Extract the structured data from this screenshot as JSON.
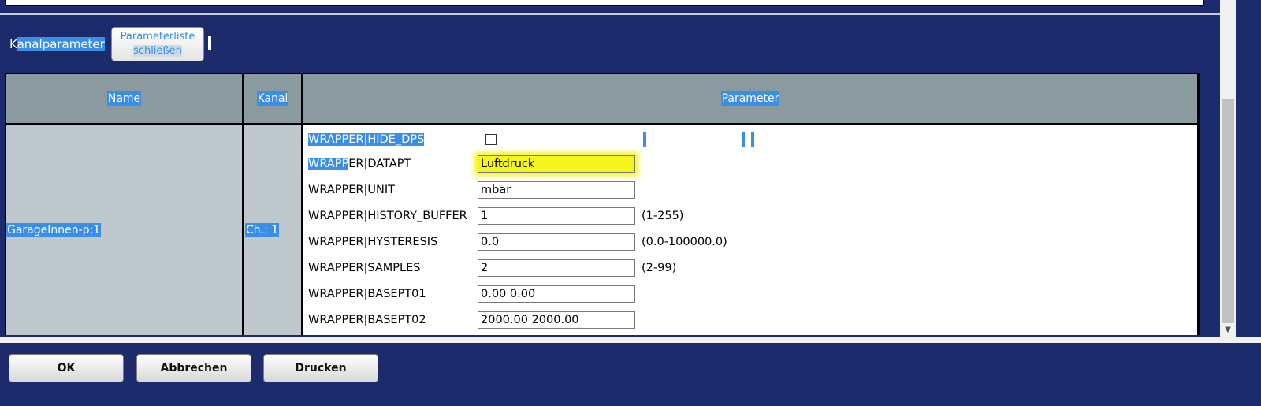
{
  "header": {
    "kanalparameter_first": "K",
    "kanalparameter_rest": "analparameter",
    "close_button_line1": "Parameterliste",
    "close_button_line2": "schließen"
  },
  "table": {
    "columns": {
      "name": "Name",
      "kanal": "Kanal",
      "parameter": "Parameter"
    },
    "row": {
      "name": "GarageInnen-p:1",
      "kanal": "Ch.: 1"
    }
  },
  "params": [
    {
      "label": "WRAPPER|HIDE_DPS",
      "type": "checkbox",
      "checked": false
    },
    {
      "label_selected": "WRAPP",
      "label_rest": "ER|DATAPT",
      "value": "Luftdruck",
      "highlighted": true
    },
    {
      "label": "WRAPPER|UNIT",
      "value": "mbar"
    },
    {
      "label": "WRAPPER|HISTORY_BUFFER",
      "value": "1",
      "range": "(1-255)"
    },
    {
      "label": "WRAPPER|HYSTERESIS",
      "value": "0.0",
      "range": "(0.0-100000.0)"
    },
    {
      "label": "WRAPPER|SAMPLES",
      "value": "2",
      "range": "(2-99)"
    },
    {
      "label": "WRAPPER|BASEPT01",
      "value": "0.00 0.00"
    },
    {
      "label": "WRAPPER|BASEPT02",
      "value": "2000.00 2000.00"
    }
  ],
  "footer": {
    "ok": "OK",
    "cancel": "Abbrechen",
    "print": "Drucken"
  },
  "colors": {
    "background": "#1b2b6c",
    "selection": "#3a8ee6",
    "header_cell": "#8b9a9e",
    "cell": "#bfc9cd",
    "highlight": "#f5f51e"
  }
}
